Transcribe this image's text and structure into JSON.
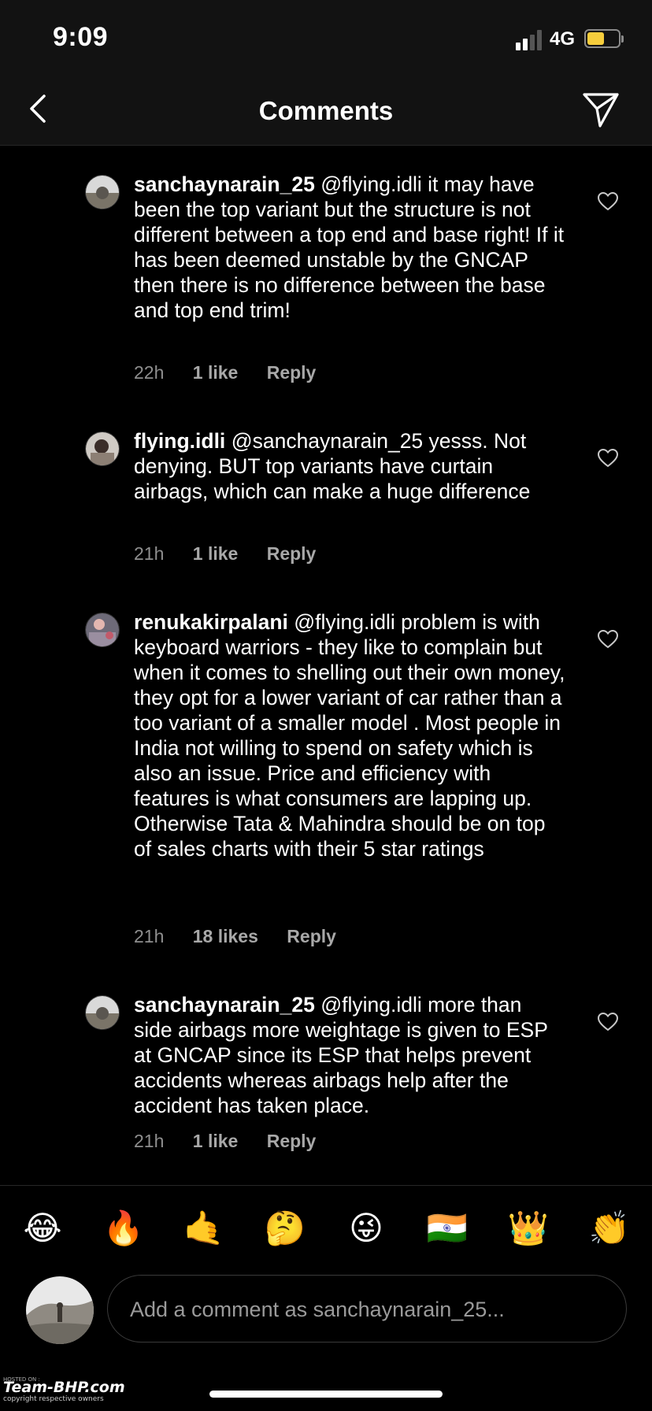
{
  "status": {
    "time": "9:09",
    "network": "4G",
    "battery_level": 0.55
  },
  "header": {
    "title": "Comments"
  },
  "comments": [
    {
      "user": "sanchaynarain_25",
      "text": "@flying.idli it may have been the top variant but the structure is not different between a top end and base right! If it has been deemed unstable by the GNCAP then there is no difference between the base and top end trim!",
      "age": "22h",
      "likes": "1 like",
      "reply": "Reply"
    },
    {
      "user": "flying.idli",
      "text": "@sanchaynarain_25 yesss. Not denying. BUT top variants have curtain airbags, which can make a huge difference",
      "age": "21h",
      "likes": "1 like",
      "reply": "Reply"
    },
    {
      "user": "renukakirpalani",
      "text": "@flying.idli problem is with keyboard warriors - they like to complain but when it comes to shelling out their own money, they opt for a  lower variant of car rather than a too variant of a smaller model . Most people in India not willing to spend  on safety which is also an issue. Price and efficiency with features is what consumers are lapping up.  Otherwise Tata & Mahindra should be on top of sales charts with their 5 star ratings",
      "age": "21h",
      "likes": "18 likes",
      "reply": "Reply"
    },
    {
      "user": "sanchaynarain_25",
      "text": "@flying.idli more than side airbags more weightage is given to ESP at GNCAP since its ESP that helps prevent accidents whereas airbags help after the accident has taken place.",
      "age": "21h",
      "likes": "1 like",
      "reply": "Reply"
    }
  ],
  "emoji_bar": [
    "😂",
    "🔥",
    "🤙",
    "🤔",
    "😜",
    "🇮🇳",
    "👑",
    "👏"
  ],
  "composer": {
    "placeholder": "Add a comment as sanchaynarain_25..."
  },
  "watermark": {
    "small": "HOSTED ON :",
    "brand": "Team-BHP.com",
    "sub": "copyright respective owners"
  },
  "colors": {
    "background": "#000000",
    "header": "#121212",
    "secondary_text": "#8e8e8e",
    "battery": "#f6cd3c"
  }
}
